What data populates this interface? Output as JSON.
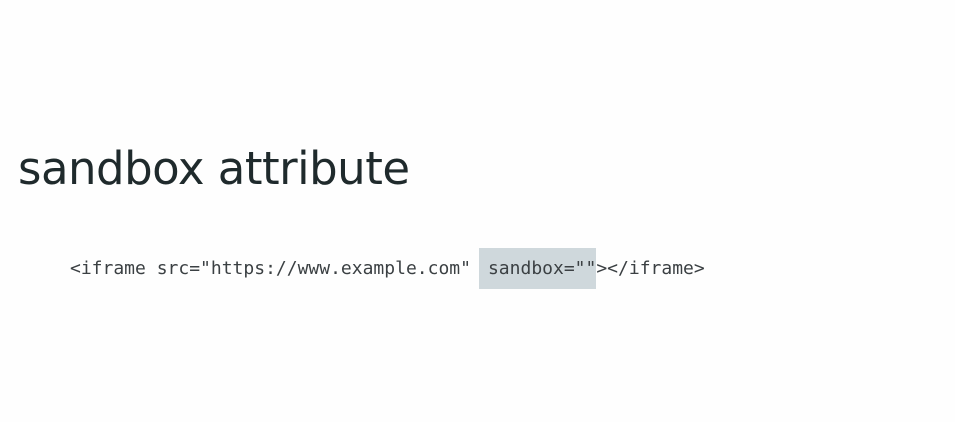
{
  "slide": {
    "title": "sandbox attribute",
    "code": {
      "before": "<iframe src=\"https://www.example.com\"",
      "highlight": "sandbox=\"\"",
      "after": "></iframe>"
    }
  },
  "colors": {
    "background": "#fefefe",
    "title_text": "#1f2a2c",
    "code_text": "#3b4043",
    "highlight_background": "#cfd8dc"
  }
}
